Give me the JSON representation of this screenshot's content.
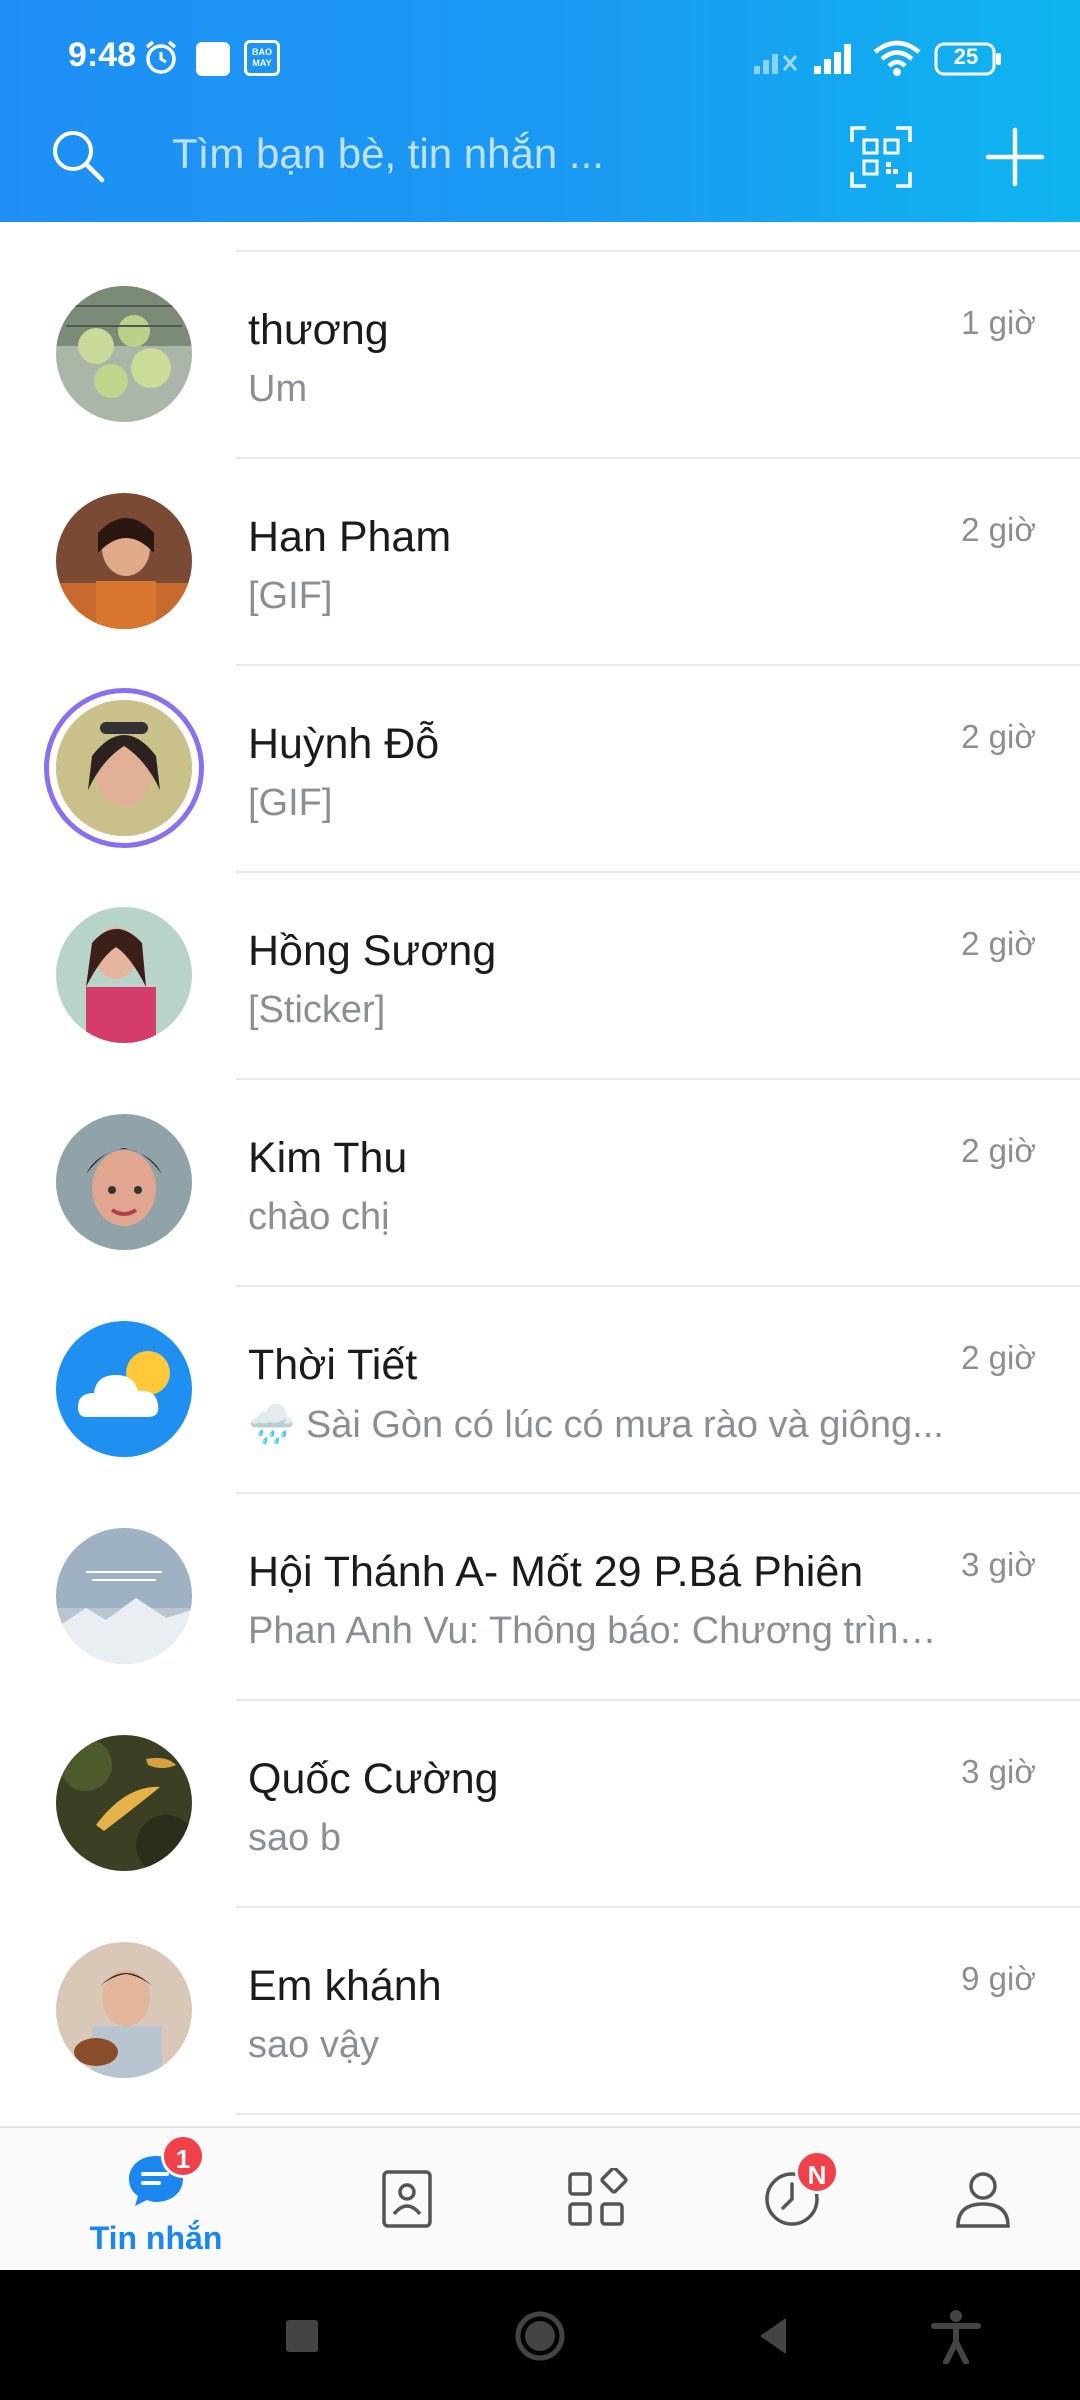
{
  "status_bar": {
    "time": "9:48",
    "battery": "25",
    "app_badge": "BAO MAY"
  },
  "header": {
    "search_placeholder": "Tìm bạn bè, tin nhắn ..."
  },
  "conversations": [
    {
      "name": "thương",
      "preview": "Um",
      "time": "1 giờ"
    },
    {
      "name": "Han Pham",
      "preview": "[GIF]",
      "time": "2 giờ"
    },
    {
      "name": "Huỳnh Đỗ",
      "preview": "[GIF]",
      "time": "2 giờ"
    },
    {
      "name": "Hồng Sương",
      "preview": "[Sticker]",
      "time": "2 giờ"
    },
    {
      "name": "Kim Thu",
      "preview": "chào chị",
      "time": "2 giờ"
    },
    {
      "name": "Thời Tiết",
      "preview": "🌧️ Sài Gòn có lúc có mưa rào và giông...",
      "time": "2 giờ"
    },
    {
      "name": "Hội Thánh A- Mốt 29 P.Bá Phiên",
      "preview": "Phan Anh Vu: Thông báo: Chương trình...",
      "time": "3 giờ"
    },
    {
      "name": "Quốc Cường",
      "preview": "sao b",
      "time": "3 giờ"
    },
    {
      "name": "Em khánh",
      "preview": "sao vậy",
      "time": "9 giờ"
    }
  ],
  "tabbar": {
    "messages_label": "Tin nhắn",
    "messages_badge": "1",
    "timeline_badge": "N"
  },
  "colors": {
    "brand_blue": "#1f8ff5",
    "active_tab": "#1b86f0",
    "badge_red": "#f0404a"
  }
}
